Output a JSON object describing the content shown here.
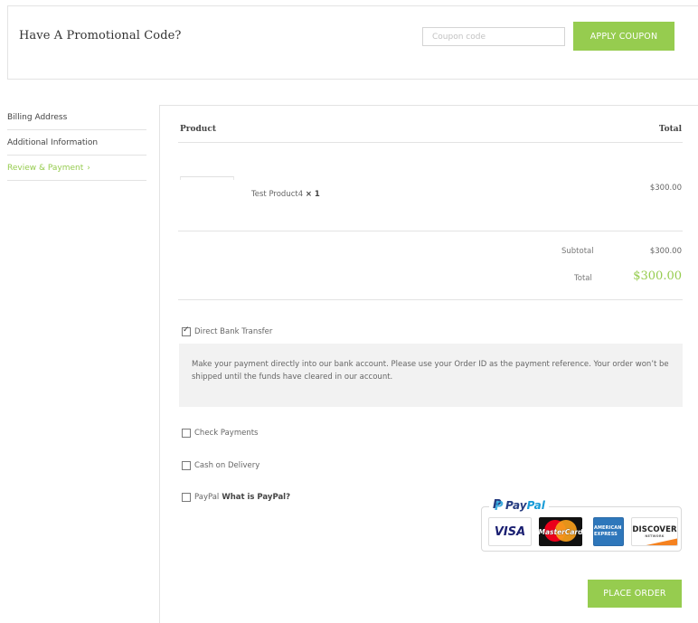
{
  "coupon": {
    "title": "Have A Promotional Code?",
    "placeholder": "Coupon code",
    "apply_label": "APPLY COUPON"
  },
  "sidebar": {
    "items": [
      {
        "label": "Billing Address"
      },
      {
        "label": "Additional Information"
      },
      {
        "label": "Review & Payment",
        "active": true,
        "suffix": "›"
      }
    ]
  },
  "order": {
    "header_product": "Product",
    "header_total": "Total",
    "items": [
      {
        "name": "Test Product4",
        "qty": "× 1",
        "total": "$300.00"
      }
    ],
    "subtotal_label": "Subtotal",
    "subtotal_value": "$300.00",
    "total_label": "Total",
    "total_value": "$300.00"
  },
  "payment": {
    "methods": [
      {
        "label": "Direct Bank Transfer",
        "checked": true
      },
      {
        "label": "Check Payments",
        "checked": false
      },
      {
        "label": "Cash on Delivery",
        "checked": false
      },
      {
        "label": "PayPal",
        "link": "What is PayPal?",
        "checked": false
      }
    ],
    "bank_description": "Make your payment directly into our bank account. Please use your Order ID as the payment reference. Your order won’t be shipped until the funds have cleared in our account.",
    "paypal_logo_pay": "Pay",
    "paypal_logo_pal": "Pal",
    "cards": [
      "VISA",
      "MasterCard",
      "AMERICAN EXPRESS",
      "DISCOVER",
      "NETWORK"
    ]
  },
  "place_order_label": "PLACE ORDER",
  "colors": {
    "accent": "#96cc4f",
    "border": "#e3e3e3",
    "description_bg": "#f2f2f2"
  }
}
